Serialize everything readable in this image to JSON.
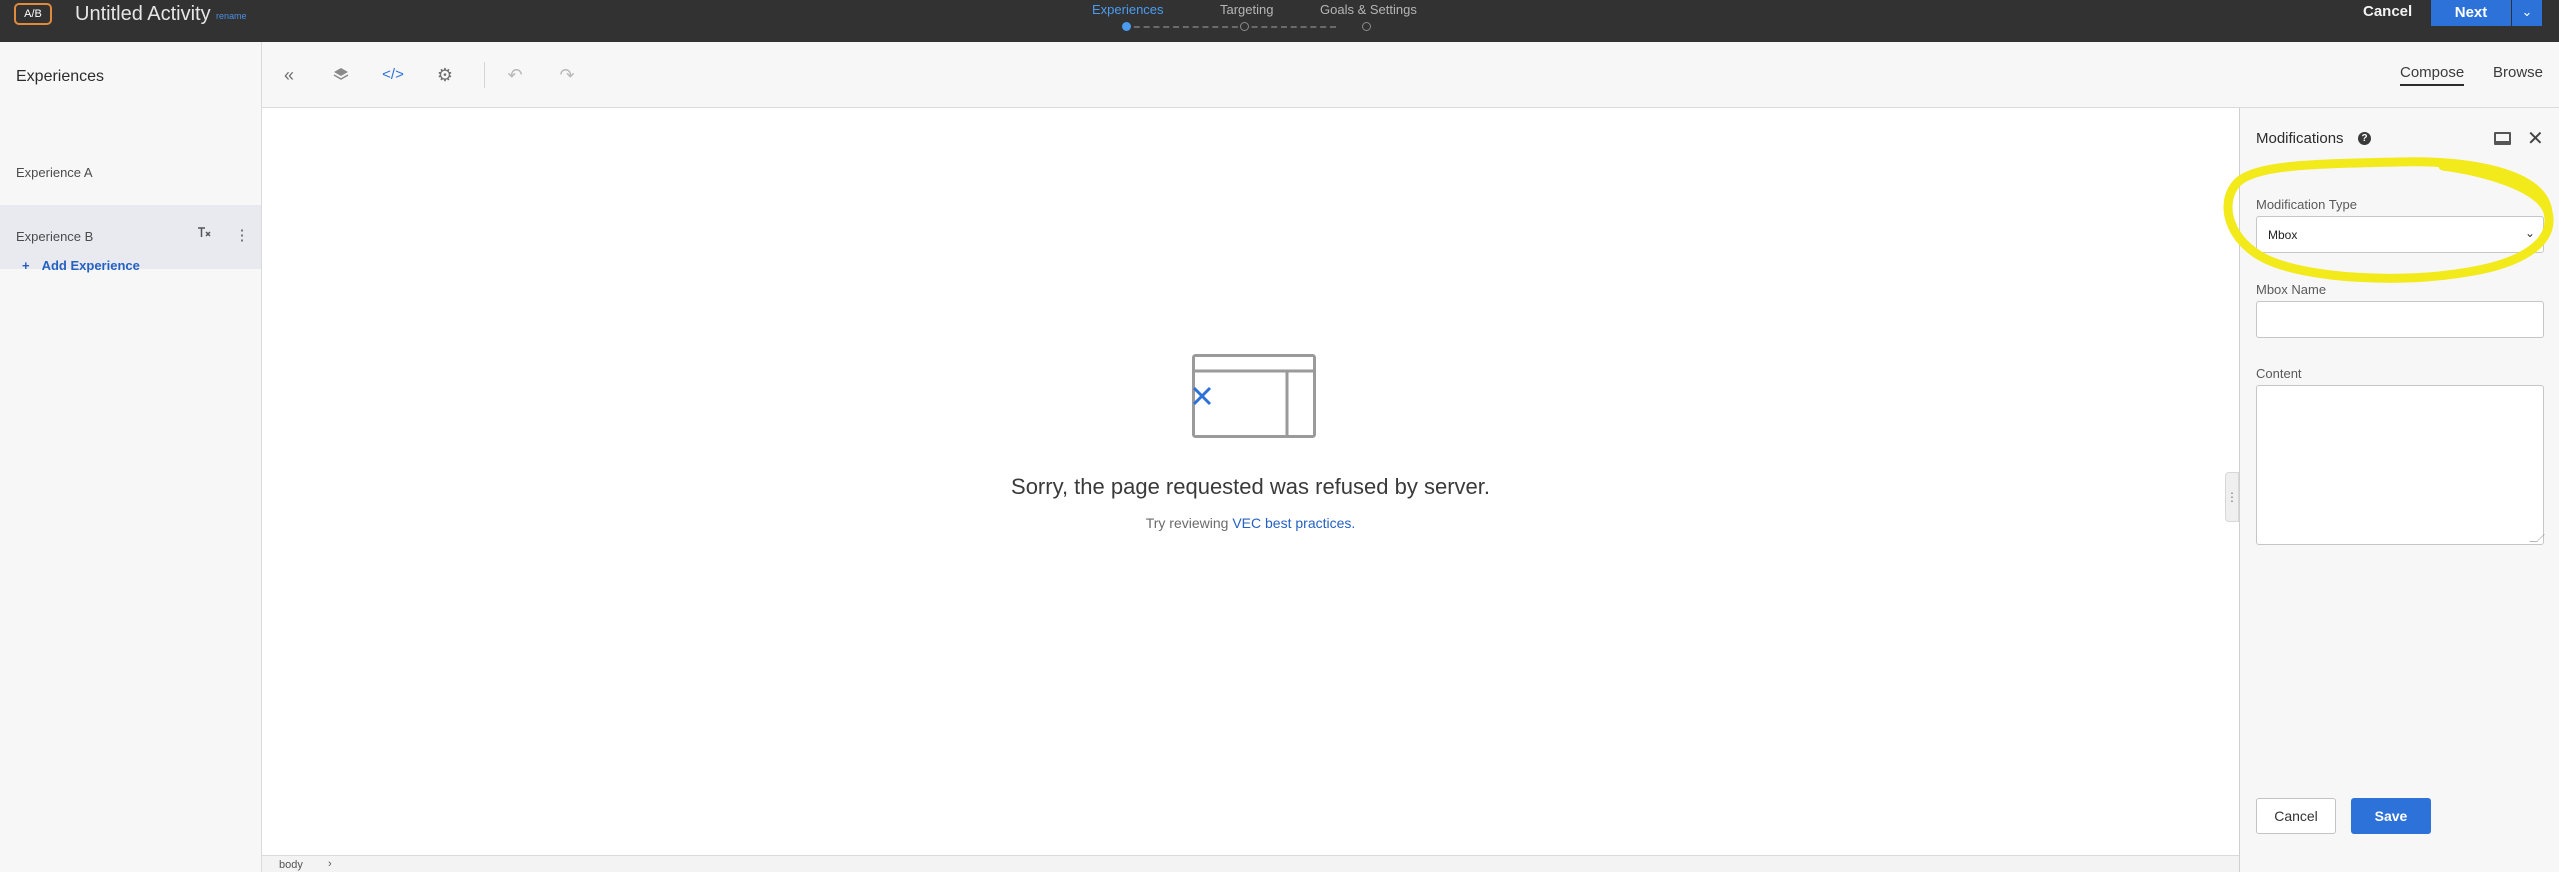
{
  "topbar": {
    "badge": "A/B",
    "activity_title": "Untitled Activity",
    "rename_link": "rename",
    "steps": [
      "Experiences",
      "Targeting",
      "Goals & Settings"
    ],
    "active_step": 0,
    "cancel_label": "Cancel",
    "next_label": "Next",
    "accent_color": "#2d72d9"
  },
  "sidebar": {
    "title": "Experiences",
    "experiences": [
      {
        "label": "Experience A",
        "selected": false
      },
      {
        "label": "Experience B",
        "selected": true
      }
    ],
    "add_label": "Add Experience"
  },
  "toolbar": {
    "icons": [
      "collapse-left-icon",
      "layers-icon",
      "code-icon",
      "gear-icon",
      "undo-icon",
      "redo-icon"
    ],
    "active_icon": "code-icon",
    "tabs": [
      "Compose",
      "Browse"
    ],
    "active_tab": "Compose"
  },
  "canvas": {
    "message": "Sorry, the page requested was refused by server.",
    "hint_prefix": "Try reviewing",
    "hint_link": "VEC best practices."
  },
  "pathbar": {
    "segment": "body"
  },
  "panel": {
    "title": "Modifications",
    "modification_type_label": "Modification Type",
    "modification_type_value": "Mbox",
    "mbox_name_label": "Mbox Name",
    "mbox_name_value": "",
    "content_label": "Content",
    "content_value": "",
    "cancel_label": "Cancel",
    "save_label": "Save"
  },
  "annotation_color": "#f2ea1a"
}
